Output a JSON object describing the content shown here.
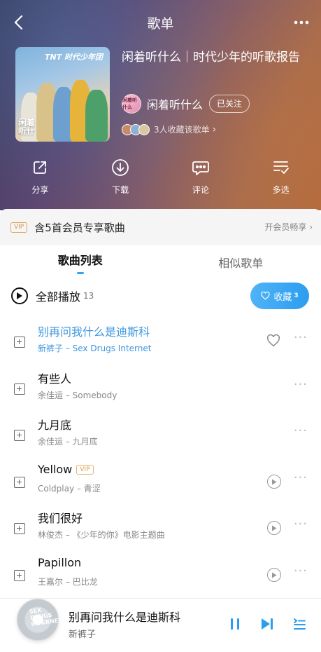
{
  "header": {
    "title": "歌单",
    "back_icon": "back-chevron-icon",
    "more_icon": "more-dots-icon"
  },
  "playlist": {
    "title": "闲着听什么｜时代少年的听歌报告",
    "cover_logo": "TNT 时代少年团",
    "cover_badge_line1": "闲着",
    "cover_badge_line2": "听什",
    "creator_name": "闲着听什么",
    "creator_avatar_text": "闲着听什么",
    "follow_label": "已关注",
    "collectors_text": "3人收藏该歌单",
    "collectors_chevron": "›"
  },
  "actions": [
    {
      "label": "分享",
      "icon": "share-icon"
    },
    {
      "label": "下载",
      "icon": "download-icon"
    },
    {
      "label": "评论",
      "icon": "comment-icon"
    },
    {
      "label": "多选",
      "icon": "multi-select-icon"
    }
  ],
  "vip_bar": {
    "tag": "VIP",
    "text": "含5首会员专享歌曲",
    "link": "开会员畅享 ›"
  },
  "tabs": [
    {
      "label": "歌曲列表",
      "active": true
    },
    {
      "label": "相似歌单",
      "active": false
    }
  ],
  "play_all": {
    "label": "全部播放",
    "count": "13",
    "collect_label": "收藏",
    "collect_count": "3"
  },
  "songs": [
    {
      "title": "别再问我什么是迪斯科",
      "subtitle": "新裤子 – Sex Drugs Internet",
      "playing": true,
      "vip": "",
      "right_icon": "heart-icon"
    },
    {
      "title": "有些人",
      "subtitle": "余佳运 – Somebody",
      "playing": false,
      "vip": "",
      "right_icon": ""
    },
    {
      "title": "九月底",
      "subtitle": "余佳运 – 九月底",
      "playing": false,
      "vip": "",
      "right_icon": ""
    },
    {
      "title": "Yellow",
      "subtitle": "Coldplay – 青涩",
      "playing": false,
      "vip": "VIP",
      "right_icon": "mv-play-icon"
    },
    {
      "title": "我们很好",
      "subtitle": "林俊杰 – 《少年的你》电影主题曲",
      "playing": false,
      "vip": "",
      "right_icon": "mv-play-icon"
    },
    {
      "title": "Papillon",
      "subtitle": "王嘉尔 – 巴比龙",
      "playing": false,
      "vip": "",
      "right_icon": "mv-play-icon"
    }
  ],
  "now_playing": {
    "title": "别再问我什么是迪斯科",
    "artist": "新裤子",
    "disc_text": "SEX DRUGS INTERNET"
  },
  "colors": {
    "accent": "#31a4f5",
    "playing_text": "#3d96e0",
    "vip_gold": "#d9954a"
  }
}
